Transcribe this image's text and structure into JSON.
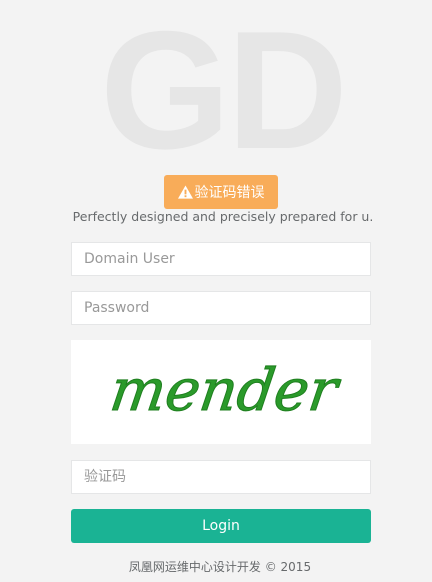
{
  "logo": {
    "text": "GD"
  },
  "alert": {
    "icon": "warning-icon",
    "message": "验证码错误",
    "color": "#f8ac59"
  },
  "tagline": "Perfectly designed and precisely prepared for u.",
  "form": {
    "username_placeholder": "Domain User",
    "password_placeholder": "Password",
    "captcha_text": "mender",
    "captcha_placeholder": "验证码",
    "login_label": "Login",
    "login_color": "#1ab394"
  },
  "footer": "凤凰网运维中心设计开发 © 2015"
}
